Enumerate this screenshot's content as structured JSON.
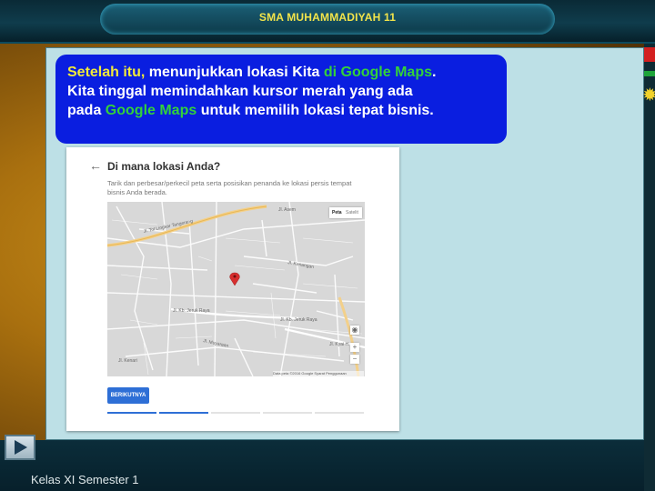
{
  "header": {
    "title": "SMA MUHAMMADIYAH 11"
  },
  "callout": {
    "line1_a": "Setelah itu,",
    "line1_b": " menunjukkan lokasi Kita ",
    "line1_c": "di",
    "line1_d": " ",
    "line1_e": "Google Maps",
    "line1_f": ".",
    "line2": "Kita tinggal memindahkan kursor merah yang ada",
    "line3_a": "pada ",
    "line3_b": "Google Maps",
    "line3_c": " untuk memilih lokasi tepat bisnis."
  },
  "form": {
    "heading": "Di mana lokasi Anda?",
    "description": "Tarik dan perbesar/perkecil peta serta posisikan penanda ke lokasi persis tempat bisnis Anda berada.",
    "map_toggle": {
      "map": "Peta",
      "satellite": "Satelit"
    },
    "map_footer": "Data peta ©2016 Google   Syarat Penggunaan",
    "street_labels": [
      "Jl. Tol Lingkar Tangerang",
      "Jl. Kb. Jeruk Raya",
      "Jl. Muyarean",
      "Jl. Kb. Jeruk Raya",
      "Jl. Kyai H.",
      "Jl. Kenangan",
      "Jl. Asem",
      "Jl. Kenari"
    ],
    "next_label": "BERIKUTNYA",
    "progress": {
      "active_step": 2,
      "total_steps": 5
    }
  },
  "footer": {
    "text": "Kelas XI Semester 1"
  },
  "colors": {
    "callout_bg": "#0a1ee0",
    "highlight_yellow": "#f2ea3a",
    "highlight_green": "#33d13a",
    "title": "#f2e44a"
  }
}
